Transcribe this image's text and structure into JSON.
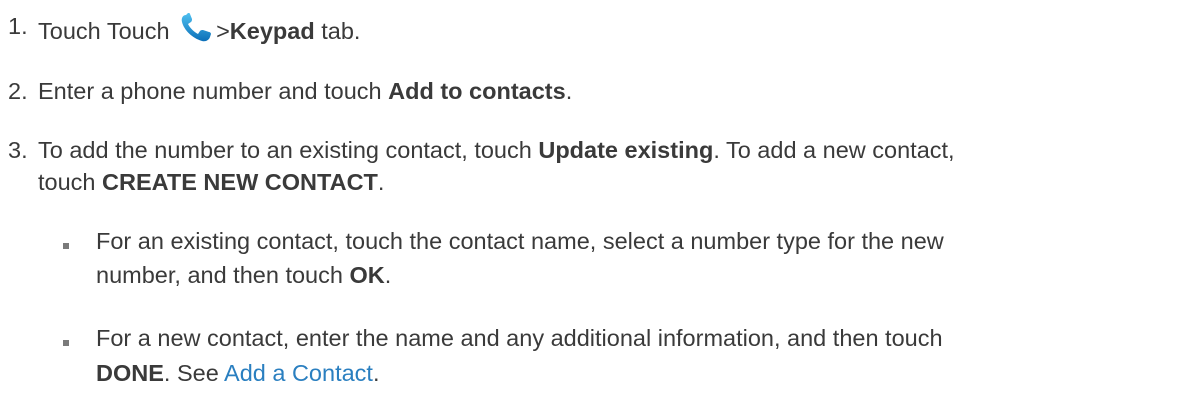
{
  "steps": [
    {
      "number": "1.",
      "parts": {
        "a": "Touch Touch",
        "icon": "phone-icon",
        "b": ">",
        "c": "Keypad",
        "d": " tab."
      }
    },
    {
      "number": "2.",
      "parts": {
        "a": "Enter a phone number and touch ",
        "b": "Add to contacts",
        "c": "."
      }
    },
    {
      "number": "3.",
      "parts": {
        "a": "To add the number to an existing contact, touch ",
        "b": "Update existing",
        "c": ". To add a new contact,",
        "d": "touch ",
        "e": "CREATE NEW CONTACT",
        "f": "."
      }
    }
  ],
  "bullets": [
    {
      "a": "For an existing contact, touch the contact name, select a number type for the new",
      "b": "number, and then touch ",
      "c": "OK",
      "d": "."
    },
    {
      "a": "For a new contact, enter the name and any additional information, and then touch",
      "b": "DONE",
      "c": ". See ",
      "link": "Add a Contact",
      "d": "."
    }
  ],
  "colors": {
    "text": "#3a3a3a",
    "link": "#2a7fc0",
    "icon": "#1a8fd6"
  }
}
